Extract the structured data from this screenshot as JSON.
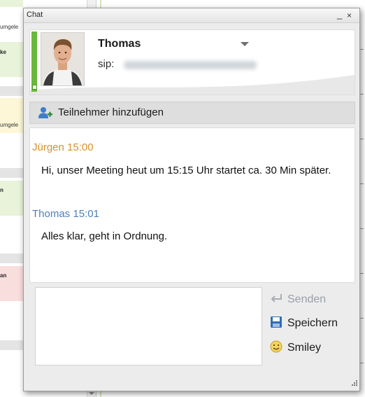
{
  "background": {
    "row_labels": [
      "umgele",
      "ke",
      "umgele",
      "n",
      "an"
    ],
    "block_colors": [
      "#e9f3da",
      "#fdf7d7",
      "#fdf7d7",
      "#e9f3da",
      "#f9dede"
    ]
  },
  "chat": {
    "window_title": "Chat",
    "controls": {
      "minimize": "_",
      "close": "×"
    },
    "contact": {
      "name": "Thomas",
      "sip_prefix": "sip:",
      "presence_color": "#68b83a"
    },
    "add_participants_label": "Teilnehmer hinzufügen",
    "messages": [
      {
        "sender": "Jürgen 15:00",
        "sender_color": "#d8922a",
        "text": "Hi, unser Meeting heut um 15:15 Uhr startet ca. 30 Min später."
      },
      {
        "sender": "Thomas 15:01",
        "sender_color": "#4e7fb8",
        "text": "Alles klar, geht in Ordnung."
      }
    ],
    "input": {
      "value": ""
    },
    "actions": {
      "send": "Senden",
      "save": "Speichern",
      "smiley": "Smiley"
    },
    "icons": {
      "add_participants": "add-person-icon",
      "send": "send-arrow-icon",
      "save": "floppy-disk-icon",
      "smiley": "smiley-icon"
    }
  }
}
